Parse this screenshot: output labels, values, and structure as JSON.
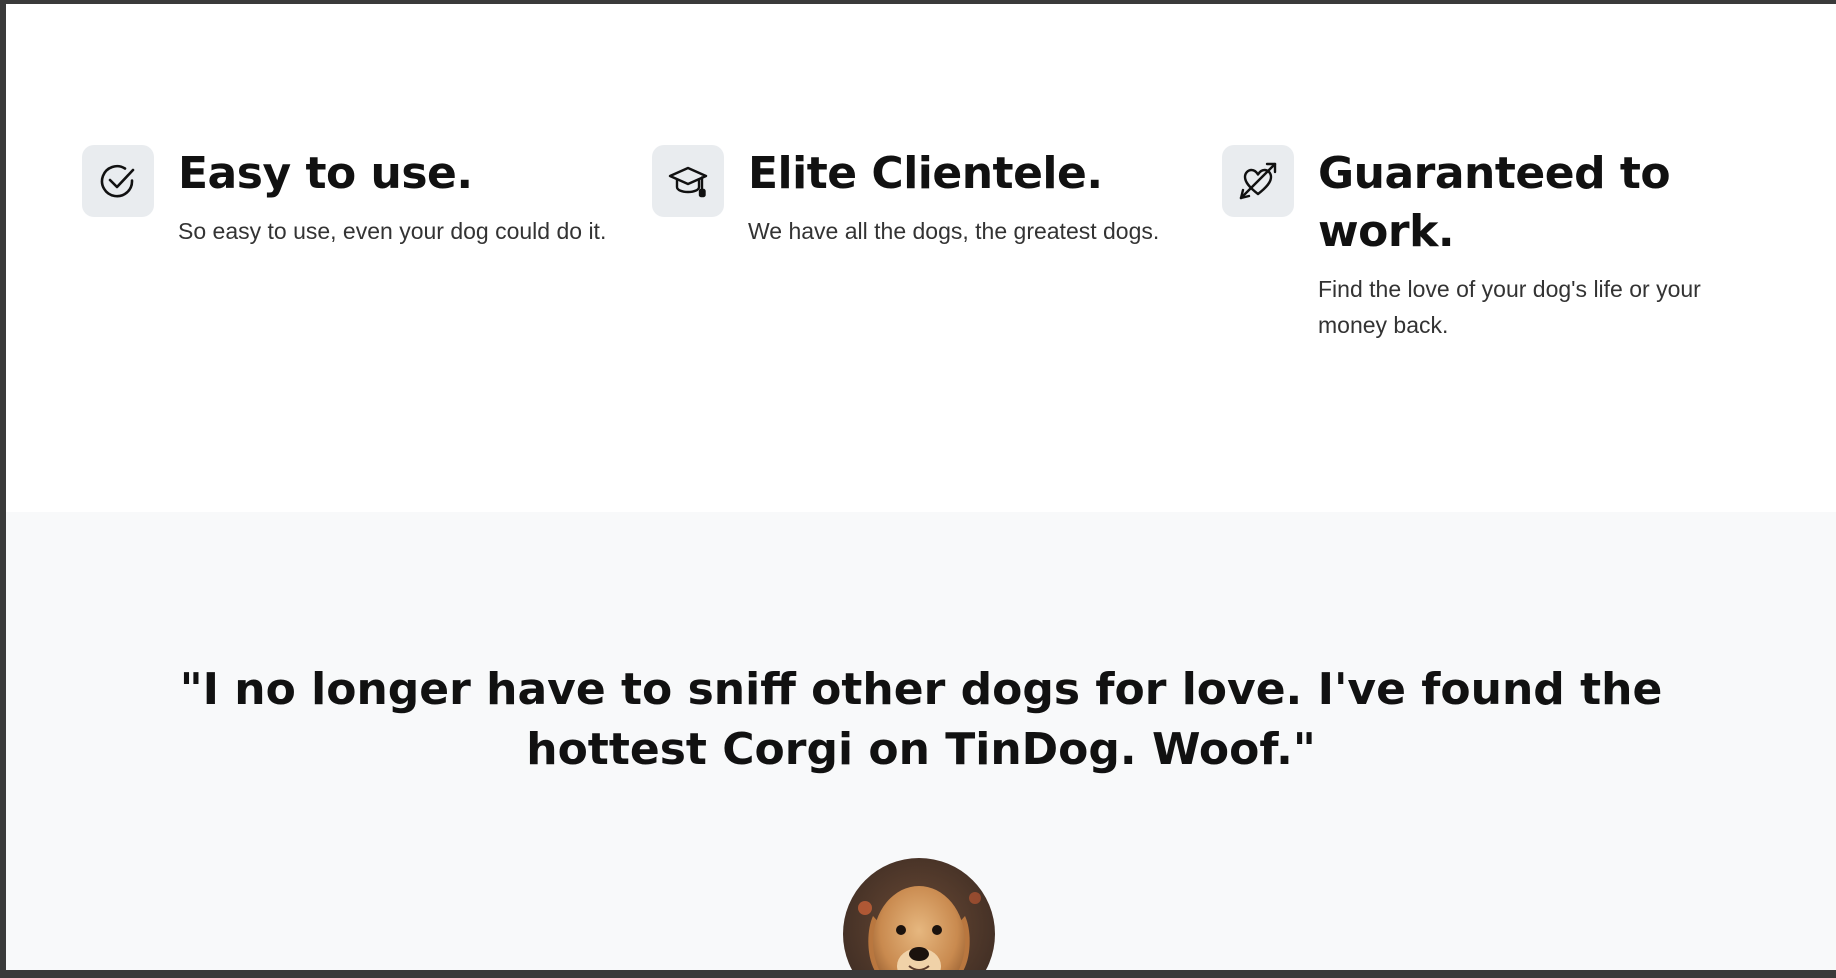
{
  "features": [
    {
      "icon": "check-circle-icon",
      "title": "Easy to use.",
      "text": "So easy to use, even your dog could do it."
    },
    {
      "icon": "graduation-cap-icon",
      "title": "Elite Clientele.",
      "text": "We have all the dogs, the greatest dogs."
    },
    {
      "icon": "heart-arrow-icon",
      "title": "Guaranteed to work.",
      "text": "Find the love of your dog's life or your money back."
    }
  ],
  "testimonial": {
    "quote": "\"I no longer have to sniff other dogs for love. I've found the hottest Corgi on TinDog. Woof.\"",
    "avatar_icon": "dog-avatar"
  },
  "colors": {
    "features_bg": "#ffffff",
    "testimonial_bg": "#f8f9fa",
    "icon_box_bg": "#e9ecef",
    "heading": "#111111",
    "body_text": "#333333"
  }
}
